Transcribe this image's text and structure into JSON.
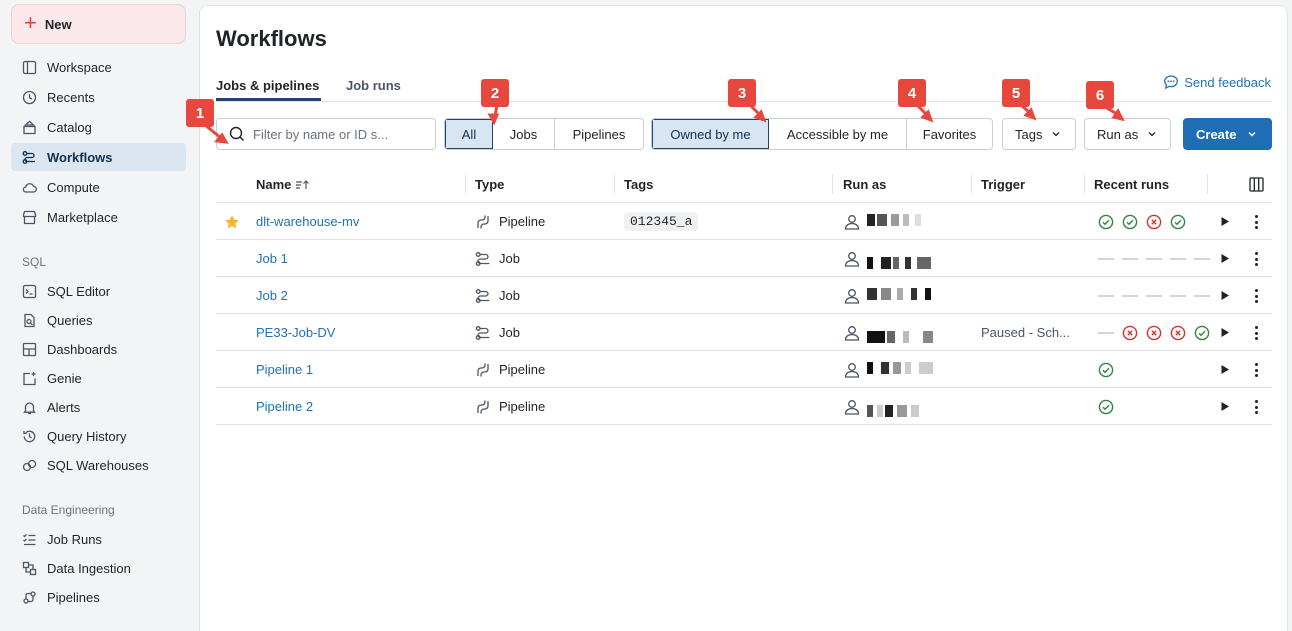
{
  "sidebar": {
    "new_label": "New",
    "items": [
      {
        "label": "Workspace",
        "icon": "workspace-icon"
      },
      {
        "label": "Recents",
        "icon": "clock-icon"
      },
      {
        "label": "Catalog",
        "icon": "catalog-icon"
      },
      {
        "label": "Workflows",
        "icon": "workflows-icon",
        "active": true
      },
      {
        "label": "Compute",
        "icon": "cloud-icon"
      },
      {
        "label": "Marketplace",
        "icon": "store-icon"
      }
    ],
    "sql_section": "SQL",
    "sql_items": [
      {
        "label": "SQL Editor",
        "icon": "sql-editor-icon"
      },
      {
        "label": "Queries",
        "icon": "query-icon"
      },
      {
        "label": "Dashboards",
        "icon": "dashboard-icon"
      },
      {
        "label": "Genie",
        "icon": "genie-icon"
      },
      {
        "label": "Alerts",
        "icon": "bell-icon"
      },
      {
        "label": "Query History",
        "icon": "history-icon"
      },
      {
        "label": "SQL Warehouses",
        "icon": "warehouse-icon"
      }
    ],
    "de_section": "Data Engineering",
    "de_items": [
      {
        "label": "Job Runs",
        "icon": "job-runs-icon"
      },
      {
        "label": "Data Ingestion",
        "icon": "ingestion-icon"
      },
      {
        "label": "Pipelines",
        "icon": "pipeline-icon"
      }
    ]
  },
  "header": {
    "title": "Workflows",
    "tabs": [
      "Jobs & pipelines",
      "Job runs"
    ],
    "feedback": "Send feedback"
  },
  "filters": {
    "search_placeholder": "Filter by name or ID s...",
    "type_options": [
      "All",
      "Jobs",
      "Pipelines"
    ],
    "type_selected": "All",
    "owner_options": [
      "Owned by me",
      "Accessible by me",
      "Favorites"
    ],
    "owner_selected": "Owned by me",
    "tags_label": "Tags",
    "run_as_label": "Run as",
    "create_label": "Create"
  },
  "annotations": [
    "1",
    "2",
    "3",
    "4",
    "5",
    "6"
  ],
  "table": {
    "columns": [
      "Name",
      "Type",
      "Tags",
      "Run as",
      "Trigger",
      "Recent runs"
    ],
    "rows": [
      {
        "name": "dlt-warehouse-mv",
        "type": "Pipeline",
        "tag": "012345_a",
        "trigger": "",
        "favorite": true,
        "runs": [
          "success",
          "success",
          "failed",
          "success"
        ]
      },
      {
        "name": "Job 1",
        "type": "Job",
        "tag": "",
        "trigger": "",
        "favorite": false,
        "runs": [
          "none",
          "none",
          "none",
          "none",
          "none"
        ]
      },
      {
        "name": "Job 2",
        "type": "Job",
        "tag": "",
        "trigger": "",
        "favorite": false,
        "runs": [
          "none",
          "none",
          "none",
          "none",
          "none"
        ]
      },
      {
        "name": "PE33-Job-DV",
        "type": "Job",
        "tag": "",
        "trigger": "Paused - Sch...",
        "favorite": false,
        "runs": [
          "none",
          "failed",
          "failed",
          "failed",
          "success"
        ]
      },
      {
        "name": "Pipeline 1",
        "type": "Pipeline",
        "tag": "",
        "trigger": "",
        "favorite": false,
        "runs": [
          "success"
        ]
      },
      {
        "name": "Pipeline 2",
        "type": "Pipeline",
        "tag": "",
        "trigger": "",
        "favorite": false,
        "runs": [
          "success"
        ]
      }
    ]
  },
  "colors": {
    "accent": "#2272b4",
    "primary_button": "#1f6eb5",
    "success": "#2e8540",
    "failed": "#d0342c",
    "badge": "#e7483d"
  }
}
